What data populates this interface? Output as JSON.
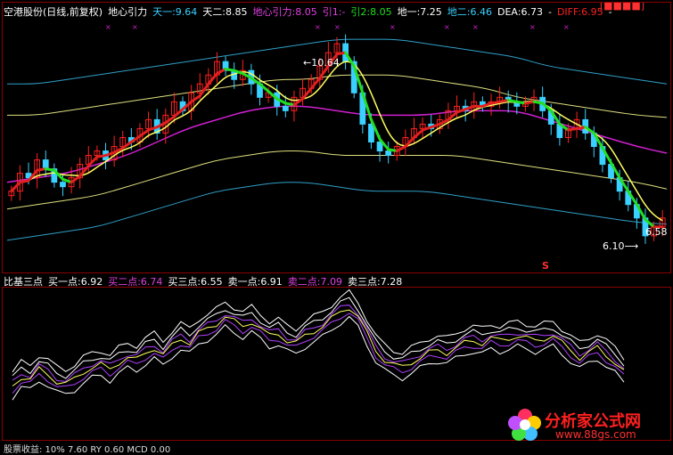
{
  "colors": {
    "background": "#000000",
    "candle_up": "#ff2020",
    "candle_down": "#3ad0ff",
    "green_line": "#22dd22",
    "red_line": "#e02020",
    "yellow_line": "#ffff60",
    "magenta_line": "#d020d0",
    "purple_line": "#b040ff",
    "white_line": "#ffffff",
    "band_cyan": "#2fa0c8",
    "band_yellow": "#e0e080",
    "band_green": "#40c040"
  },
  "header": {
    "title": "空港股份(日线,前复权)",
    "indicator": "地心引力",
    "items": [
      {
        "label": "天一:9.64",
        "color": "#3ad0ff"
      },
      {
        "label": "天二:8.85",
        "color": "#ffffff"
      },
      {
        "label": "地心引力:8.05",
        "color": "#e040e0"
      },
      {
        "label": "引1:-",
        "color": "#e040e0"
      },
      {
        "label": "引2:8.05",
        "color": "#22dd22"
      },
      {
        "label": "地一:7.25",
        "color": "#ffffff"
      },
      {
        "label": "地二:6.46",
        "color": "#3ad0ff"
      },
      {
        "label": "DEA:6.73",
        "color": "#ffffff"
      },
      {
        "label": "-",
        "color": "#ffffff"
      },
      {
        "label": "DIFF:6.95",
        "color": "#ff2020"
      },
      {
        "label": "-",
        "color": "#ffffff"
      }
    ],
    "top_right": "[■■■■]"
  },
  "sub_header": {
    "title": "比基三点",
    "items": [
      {
        "label": "买一点:6.92",
        "color": "#ffffff"
      },
      {
        "label": "买二点:6.74",
        "color": "#e040e0"
      },
      {
        "label": "买三点:6.55",
        "color": "#ffffff"
      },
      {
        "label": "卖一点:6.91",
        "color": "#ffffff"
      },
      {
        "label": "卖二点:7.09",
        "color": "#e040e0"
      },
      {
        "label": "卖三点:7.28",
        "color": "#ffffff"
      }
    ]
  },
  "annotations": {
    "high": "10.64",
    "low": "6.10",
    "last": "6.58",
    "sell_mark": "S"
  },
  "bottom_cut_text": "股票收益: 10% 7.60 RY 0.60 MCD 0.00",
  "logo": {
    "title": "分析家公式网",
    "url": "www.88gs.com"
  },
  "chart_data": {
    "type": "line",
    "title": "空港股份(日线,前复权)",
    "xlabel": "",
    "ylabel": "",
    "ylim": [
      5.5,
      11.0
    ],
    "close": [
      7.2,
      7.6,
      7.5,
      7.9,
      7.7,
      7.4,
      7.3,
      7.5,
      7.8,
      8.0,
      8.1,
      7.9,
      8.2,
      8.4,
      8.3,
      8.6,
      8.8,
      8.5,
      8.9,
      9.2,
      9.0,
      9.4,
      9.6,
      9.8,
      10.1,
      9.9,
      9.7,
      9.9,
      9.6,
      9.3,
      9.4,
      9.1,
      9.0,
      9.3,
      9.5,
      9.7,
      10.0,
      10.3,
      10.5,
      10.1,
      9.4,
      8.7,
      8.3,
      8.1,
      8.0,
      8.2,
      8.4,
      8.6,
      8.7,
      8.6,
      8.8,
      9.0,
      9.1,
      9.0,
      9.2,
      9.1,
      9.2,
      9.3,
      9.2,
      9.1,
      9.2,
      9.3,
      9.0,
      8.7,
      8.4,
      8.6,
      8.8,
      8.5,
      8.2,
      7.8,
      7.5,
      7.2,
      6.9,
      6.6,
      6.2,
      6.4,
      6.6
    ],
    "series": [
      {
        "name": "天一",
        "values": [
          9.6,
          9.6,
          9.7,
          9.8,
          9.9,
          10.0,
          10.1,
          10.2,
          10.3,
          10.4,
          10.5,
          10.6,
          10.6,
          10.6,
          10.5,
          10.4,
          10.3,
          10.2,
          10.0,
          9.9,
          9.8,
          9.7,
          9.6
        ]
      },
      {
        "name": "天二",
        "values": [
          8.9,
          8.9,
          9.0,
          9.1,
          9.2,
          9.3,
          9.4,
          9.5,
          9.6,
          9.7,
          9.7,
          9.8,
          9.8,
          9.8,
          9.7,
          9.6,
          9.5,
          9.3,
          9.2,
          9.1,
          9.0,
          8.9,
          8.85
        ]
      },
      {
        "name": "地心引力",
        "values": [
          7.4,
          7.5,
          7.6,
          7.8,
          8.0,
          8.3,
          8.6,
          8.8,
          9.0,
          9.1,
          9.1,
          9.0,
          8.9,
          8.9,
          8.9,
          9.0,
          9.0,
          9.0,
          8.8,
          8.6,
          8.4,
          8.2,
          8.05
        ]
      },
      {
        "name": "地一",
        "values": [
          6.8,
          6.9,
          7.0,
          7.1,
          7.3,
          7.5,
          7.7,
          7.9,
          8.0,
          8.1,
          8.1,
          8.0,
          8.0,
          8.0,
          8.0,
          8.0,
          7.9,
          7.8,
          7.7,
          7.6,
          7.5,
          7.4,
          7.25
        ]
      },
      {
        "name": "地二",
        "values": [
          6.1,
          6.2,
          6.3,
          6.4,
          6.6,
          6.8,
          7.0,
          7.2,
          7.3,
          7.4,
          7.4,
          7.3,
          7.2,
          7.2,
          7.2,
          7.1,
          7.0,
          6.9,
          6.8,
          6.7,
          6.6,
          6.5,
          6.46
        ]
      }
    ]
  }
}
